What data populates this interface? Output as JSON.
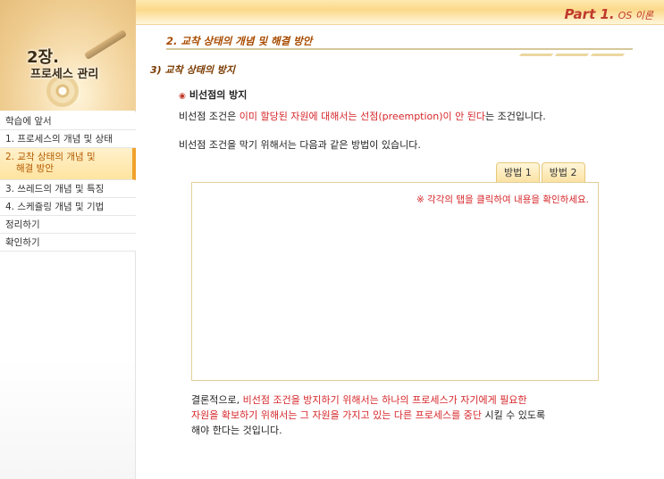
{
  "header": {
    "part_label": "Part 1.",
    "part_subtitle": "OS 이론"
  },
  "sidebar": {
    "chapter_number": "2장.",
    "chapter_name": "프로세스 관리",
    "items": [
      {
        "label": "학습에 앞서"
      },
      {
        "label": "1. 프로세스의 개념 및 상태"
      },
      {
        "label_line1": "2. 교착 상태의 개념 및",
        "label_line2": "해결 방안",
        "active": true
      },
      {
        "label": "3. 쓰레드의 개념 및 특징"
      },
      {
        "label": "4. 스케쥴링 개념 및 기법"
      },
      {
        "label": "정리하기"
      },
      {
        "label": "확인하기"
      }
    ]
  },
  "main": {
    "section_title": "2. 교착 상태의 개념 및 해결 방안",
    "sub_title": "3) 교착 상태의 방지",
    "bullet_title": "비선점의 방지",
    "para1": {
      "part1": "비선점 조건은 ",
      "part2_red": "이미 할당된 자원에 대해서는 선점(preemption)이 안 된다",
      "part3": "는 조건입니다."
    },
    "para2": "비선점 조건을 막기 위해서는 다음과 같은 방법이 있습니다.",
    "tabs": [
      "방법 1",
      "방법 2"
    ],
    "panel_note": "※ 각각의 탭을 클릭하여 내용을 확인하세요.",
    "conclusion": {
      "line1_a": "결론적으로, ",
      "line1_b_red": "비선점 조건을 방지하기 위해서는 하나의 프로세스가 자기에게 필요한",
      "line2_a_red": "자원을 확보하기 위해서는 그 자원을 가지고 있는 다른 프로세스를 중단",
      "line2_b": " 시킬 수 있도록",
      "line3": "해야 한다는 것입니다."
    }
  },
  "colors": {
    "accent_red": "#d6262a",
    "section_brown": "#a84b00",
    "active_menu": "#ffe4a0"
  }
}
